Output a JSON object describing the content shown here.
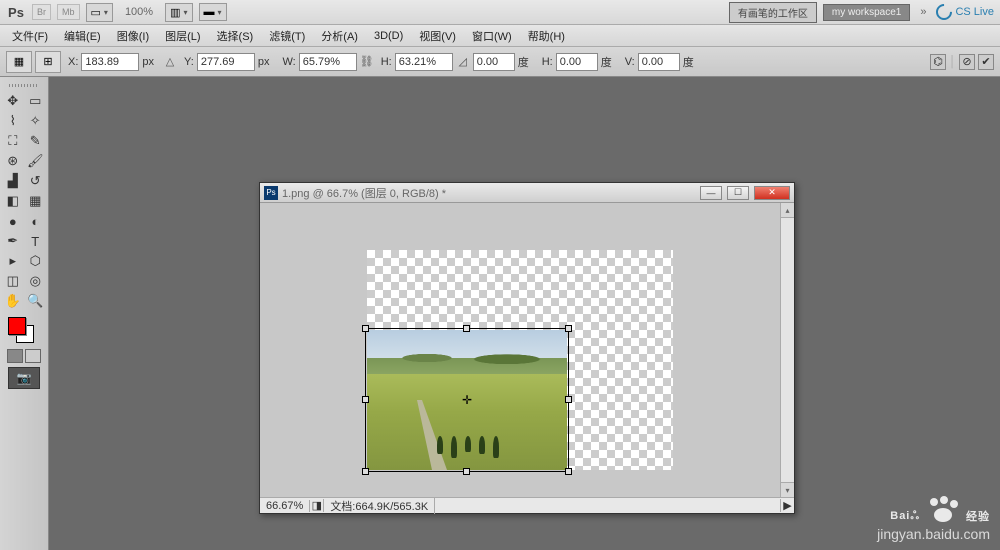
{
  "top": {
    "zoom": "100%",
    "ws_cn": "有画笔的工作区",
    "ws_name": "my workspace1",
    "cs": "CS Live"
  },
  "menu": [
    "文件(F)",
    "编辑(E)",
    "图像(I)",
    "图层(L)",
    "选择(S)",
    "滤镜(T)",
    "分析(A)",
    "3D(D)",
    "视图(V)",
    "窗口(W)",
    "帮助(H)"
  ],
  "opts": {
    "x_label": "X:",
    "x": "183.89",
    "x_unit": "px",
    "y_label": "Y:",
    "y": "277.69",
    "y_unit": "px",
    "w_label": "W:",
    "w": "65.79%",
    "h_label": "H:",
    "h": "63.21%",
    "angle": "0.00",
    "deg": "度",
    "hh_label": "H:",
    "hh": "0.00",
    "vv_label": "V:",
    "vv": "0.00"
  },
  "doc": {
    "title": "1.png @ 66.7% (图层 0, RGB/8) *",
    "zoom": "66.67%",
    "status_doc": "文档:664.9K/565.3K"
  },
  "wm": {
    "brand": "Baiஃ",
    "cn": "经验",
    "url": "jingyan.baidu.com"
  }
}
